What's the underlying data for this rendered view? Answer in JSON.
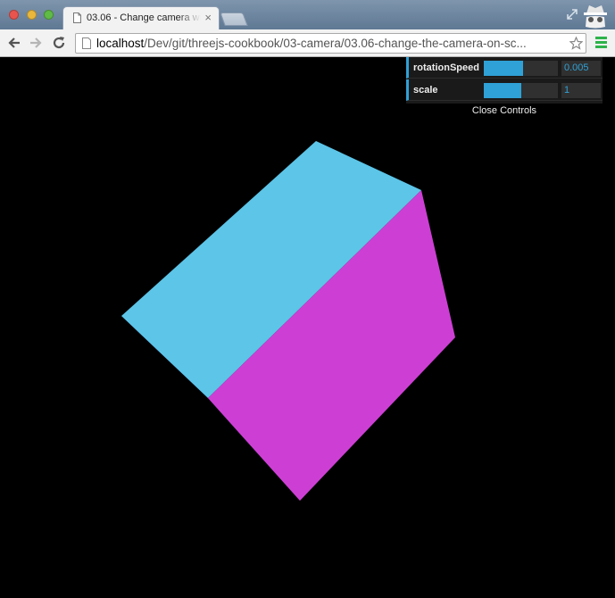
{
  "browser": {
    "tab_title": "03.06 - Change camera wi",
    "url_host": "localhost",
    "url_path": "/Dev/git/threejs-cookbook/03-camera/03.06-change-the-camera-on-sc..."
  },
  "gui": {
    "controls": [
      {
        "label": "rotationSpeed",
        "value": "0.005",
        "slider_fraction": 0.53
      },
      {
        "label": "scale",
        "value": "1",
        "slider_fraction": 0.5
      }
    ],
    "close_label": "Close Controls",
    "accent_color": "#2fa1d6"
  },
  "scene": {
    "background": "#000000",
    "cube_colors": {
      "top": "#5cc5e8",
      "front": "#cd3fd4",
      "side": "#2b1aa0"
    }
  }
}
